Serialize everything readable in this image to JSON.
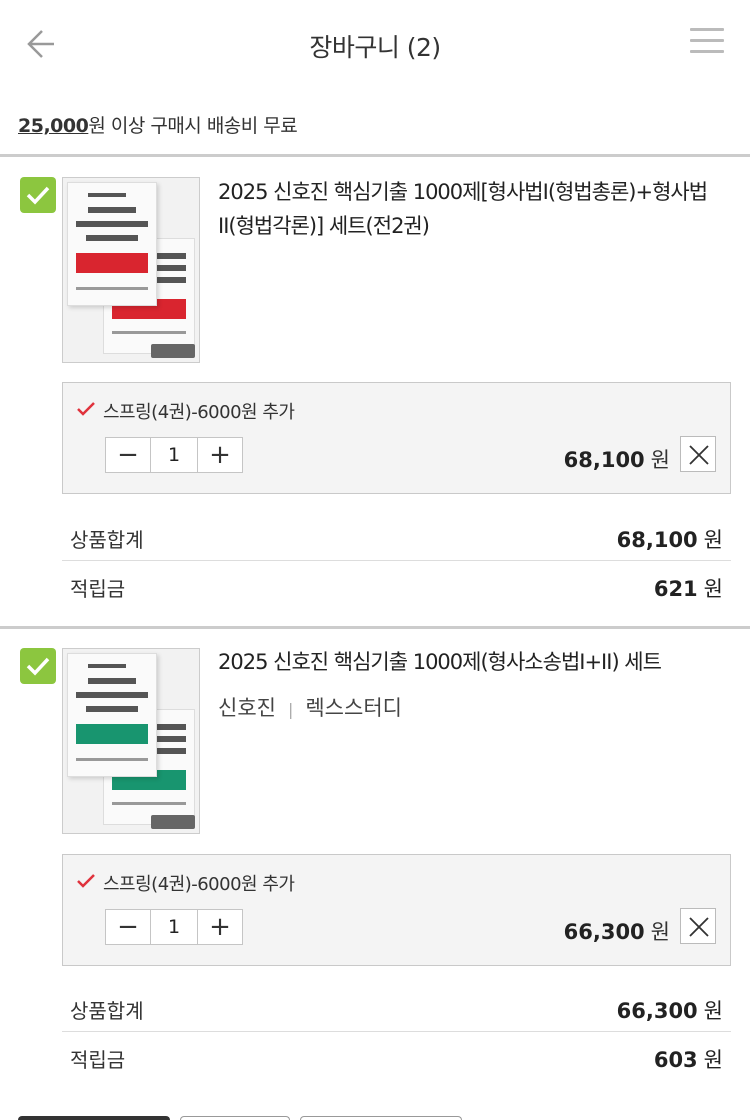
{
  "header": {
    "title": "장바구니 (2)",
    "back_icon": "arrow-left-icon",
    "menu_icon": "hamburger-menu-icon"
  },
  "shipping": {
    "amount": "25,000",
    "text": "원 이상 구매시 배송비 무료"
  },
  "colors": {
    "checkbox": "#8cc63f",
    "option_check": "#e0323c",
    "book1_accent": "#d9252f",
    "book2_accent": "#18956f"
  },
  "items": [
    {
      "title": "2025 신호진 핵심기출 1000제[형사법I(형법총론)+형사법II(형법각론)] 세트(전2권)",
      "author": "",
      "publisher": "",
      "option": {
        "label": "스프링(4권)-6000원 추가",
        "quantity": "1",
        "price": "68,100",
        "unit": "원"
      },
      "summary": {
        "total_label": "상품합계",
        "total_value": "68,100",
        "total_unit": "원",
        "points_label": "적립금",
        "points_value": "621",
        "points_unit": "원"
      }
    },
    {
      "title": "2025 신호진 핵심기출 1000제(형사소송법I+II) 세트",
      "author": "신호진",
      "publisher": "렉스스터디",
      "option": {
        "label": "스프링(4권)-6000원 추가",
        "quantity": "1",
        "price": "66,300",
        "unit": "원"
      },
      "summary": {
        "total_label": "상품합계",
        "total_value": "66,300",
        "total_unit": "원",
        "points_label": "적립금",
        "points_value": "603",
        "points_unit": "원"
      }
    }
  ],
  "qty_controls": {
    "minus": "−",
    "plus": "+"
  }
}
